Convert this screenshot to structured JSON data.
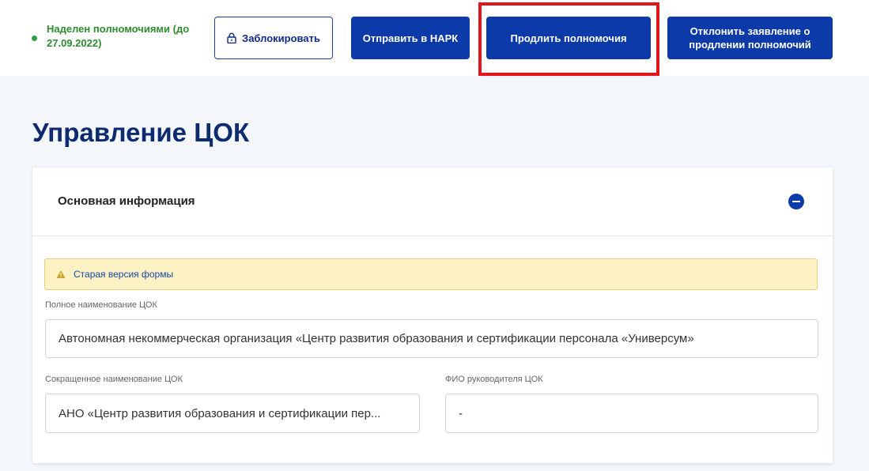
{
  "header": {
    "status_text": "Наделен полномочиями (до 27.09.2022)",
    "buttons": {
      "block": "Заблокировать",
      "send_nark": "Отправить в НАРК",
      "extend": "Продлить полномочия",
      "reject": "Отклонить заявление о продлении полномочий"
    },
    "colors": {
      "primary": "#0d3aa9",
      "status": "#2ea043",
      "highlight": "#e3161b"
    }
  },
  "page": {
    "title": "Управление ЦОК"
  },
  "card": {
    "title": "Основная информация",
    "warning": "Старая версия формы",
    "fields": {
      "full_name_label": "Полное наименование ЦОК",
      "full_name_value": "Автономная некоммерческая организация «Центр развития образования и сертификации персонала «Универсум»",
      "short_name_label": "Сокращенное наименование ЦОК",
      "short_name_value": "АНО «Центр развития образования и сертификации пер...",
      "head_label": "ФИО руководителя ЦОК",
      "head_value": "-"
    }
  },
  "icons": [
    "lock-icon",
    "warning-icon",
    "collapse-icon"
  ]
}
